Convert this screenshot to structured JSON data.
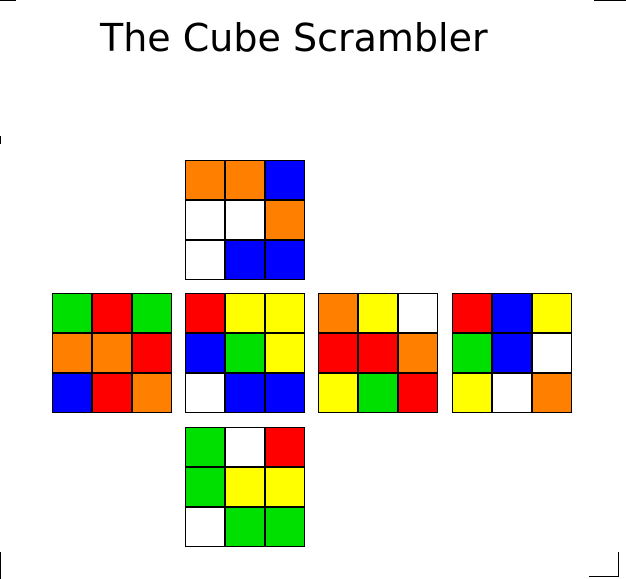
{
  "title": "The Cube Scrambler",
  "colors": {
    "W": "#ffffff",
    "Y": "#ffff00",
    "R": "#ff0000",
    "O": "#ff8000",
    "G": "#00e000",
    "B": "#0000ff"
  },
  "cube": {
    "up": [
      "O",
      "O",
      "B",
      "W",
      "W",
      "O",
      "W",
      "B",
      "B"
    ],
    "left": [
      "G",
      "R",
      "G",
      "O",
      "O",
      "R",
      "B",
      "R",
      "O"
    ],
    "front": [
      "R",
      "Y",
      "Y",
      "B",
      "G",
      "Y",
      "W",
      "B",
      "B"
    ],
    "right": [
      "O",
      "Y",
      "W",
      "R",
      "R",
      "O",
      "Y",
      "G",
      "R"
    ],
    "back": [
      "R",
      "B",
      "Y",
      "G",
      "B",
      "W",
      "Y",
      "W",
      "O"
    ],
    "down": [
      "G",
      "W",
      "R",
      "G",
      "Y",
      "Y",
      "W",
      "G",
      "G"
    ]
  }
}
